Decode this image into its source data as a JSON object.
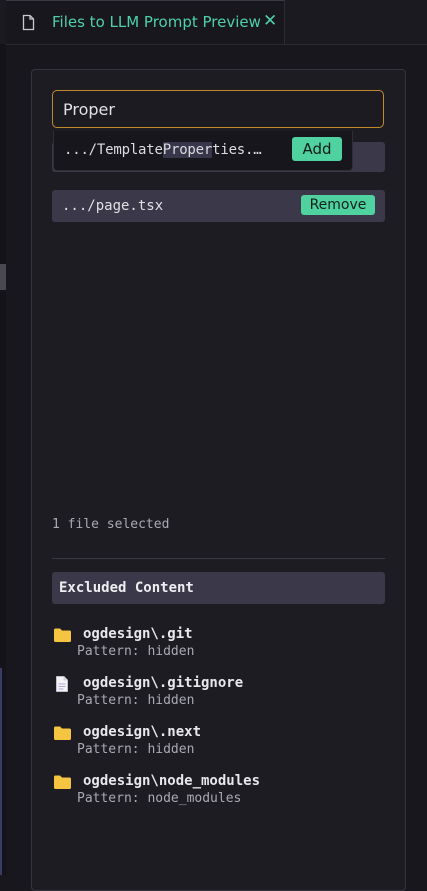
{
  "tab": {
    "title": "Files to LLM Prompt Preview",
    "close_glyph": "✕",
    "icon": "file-icon",
    "accent_color": "#4fd1a8"
  },
  "search": {
    "value": "Proper",
    "placeholder": ""
  },
  "suggestion": {
    "path_before": ".../Template",
    "path_match": "Proper",
    "path_after": "ties.…",
    "add_label": "Add"
  },
  "selected_files": [
    {
      "path": ".../page.tsx",
      "remove_label": "Remove"
    }
  ],
  "selected_count_text": "1 file selected",
  "excluded": {
    "title": "Excluded Content",
    "items": [
      {
        "name": "ogdesign\\.git",
        "pattern": "Pattern: hidden",
        "icon": "folder-icon"
      },
      {
        "name": "ogdesign\\.gitignore",
        "pattern": "Pattern: hidden",
        "icon": "file-icon"
      },
      {
        "name": "ogdesign\\.next",
        "pattern": "Pattern: hidden",
        "icon": "folder-icon"
      },
      {
        "name": "ogdesign\\node_modules",
        "pattern": "Pattern: node_modules",
        "icon": "folder-icon"
      }
    ]
  },
  "colors": {
    "button_bg": "#4fd1a0",
    "folder": "#f5c542",
    "input_border": "#c08a2c"
  }
}
